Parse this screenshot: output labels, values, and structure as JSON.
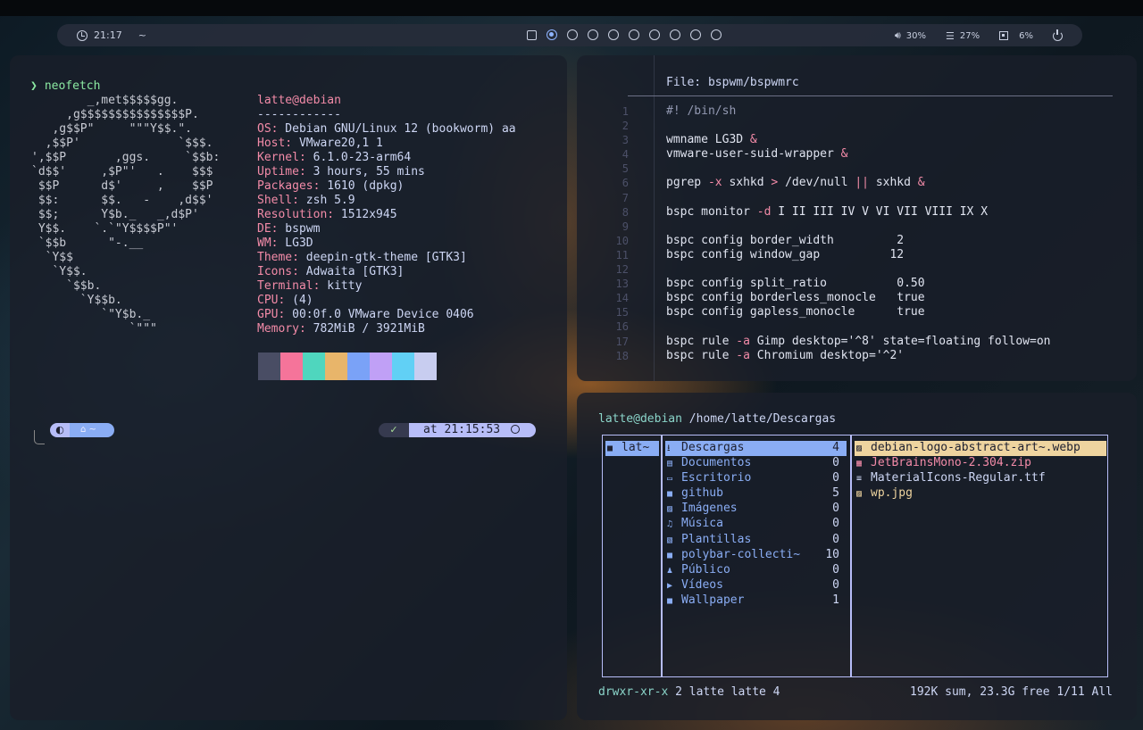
{
  "bar": {
    "time": "21:17",
    "tilde": "~",
    "workspaces": [
      "square",
      "active",
      "o",
      "o",
      "o",
      "o",
      "o",
      "o",
      "o",
      "o"
    ],
    "volume": "30%",
    "memory": "27%",
    "cpu": "6%"
  },
  "neofetch": {
    "command": "neofetch",
    "logo": "        _,met$$$$$gg.\n     ,g$$$$$$$$$$$$$$$P.\n   ,g$$P\"     \"\"\"Y$$.\".\n  ,$$P'              `$$$.\n',$$P       ,ggs.     `$$b:\n`d$$'     ,$P\"'   .    $$$\n $$P      d$'     ,    $$P\n $$:      $$.   -    ,d$$'\n $$;      Y$b._   _,d$P'\n Y$$.    `.`\"Y$$$$P\"'\n `$$b      \"-.__\n  `Y$$\n   `Y$$.\n     `$$b.\n       `Y$$b.\n          `\"Y$b._\n              `\"\"\"",
    "header": "latte@debian",
    "separator": "------------",
    "fields": [
      {
        "k": "OS",
        "v": "Debian GNU/Linux 12 (bookworm) aa"
      },
      {
        "k": "Host",
        "v": "VMware20,1 1"
      },
      {
        "k": "Kernel",
        "v": "6.1.0-23-arm64"
      },
      {
        "k": "Uptime",
        "v": "3 hours, 55 mins"
      },
      {
        "k": "Packages",
        "v": "1610 (dpkg)"
      },
      {
        "k": "Shell",
        "v": "zsh 5.9"
      },
      {
        "k": "Resolution",
        "v": "1512x945"
      },
      {
        "k": "DE",
        "v": "bspwm"
      },
      {
        "k": "WM",
        "v": "LG3D"
      },
      {
        "k": "Theme",
        "v": "deepin-gtk-theme [GTK3]"
      },
      {
        "k": "Icons",
        "v": "Adwaita [GTK3]"
      },
      {
        "k": "Terminal",
        "v": "kitty"
      },
      {
        "k": "CPU",
        "v": "(4)"
      },
      {
        "k": "GPU",
        "v": "00:0f.0 VMware Device 0406"
      },
      {
        "k": "Memory",
        "v": "782MiB / 3921MiB"
      }
    ],
    "palette": [
      "#494d64",
      "#f5749a",
      "#4fd6be",
      "#e8b56a",
      "#7aa2f7",
      "#c0a0f6",
      "#61d0f5",
      "#c8cdf0"
    ]
  },
  "prompt_line": {
    "home": "~",
    "status": "✓",
    "time": "at 21:15:53"
  },
  "editor": {
    "title": "File: bspwm/bspwmrc",
    "line_numbers": "1\n2\n3\n4\n5\n6\n7\n8\n9\n10\n11\n12\n13\n14\n15\n16\n17\n18",
    "lines": [
      "#! /bin/sh",
      "",
      "wmname LG3D &",
      "vmware-user-suid-wrapper &",
      "",
      "pgrep -x sxhkd > /dev/null || sxhkd &",
      "",
      "bspc monitor -d I II III IV V VI VII VIII IX X",
      "",
      "bspc config border_width         2",
      "bspc config window_gap          12",
      "",
      "bspc config split_ratio          0.50",
      "bspc config borderless_monocle   true",
      "bspc config gapless_monocle      true",
      "",
      "bspc rule -a Gimp desktop='^8' state=floating follow=on",
      "bspc rule -a Chromium desktop='^2'"
    ]
  },
  "ranger": {
    "user": "latte@debian",
    "path": "/home/latte/Descargas",
    "parent": "lat~",
    "dirs": [
      {
        "icon": "⭳",
        "name": "Descargas",
        "count": "4"
      },
      {
        "icon": "▤",
        "name": "Documentos",
        "count": "0"
      },
      {
        "icon": "▭",
        "name": "Escritorio",
        "count": "0"
      },
      {
        "icon": "■",
        "name": "github",
        "count": "5"
      },
      {
        "icon": "▨",
        "name": "Imágenes",
        "count": "0"
      },
      {
        "icon": "♫",
        "name": "Música",
        "count": "0"
      },
      {
        "icon": "▧",
        "name": "Plantillas",
        "count": "0"
      },
      {
        "icon": "■",
        "name": "polybar-collecti~",
        "count": "10"
      },
      {
        "icon": "♟",
        "name": "Público",
        "count": "0"
      },
      {
        "icon": "▶",
        "name": "Vídeos",
        "count": "0"
      },
      {
        "icon": "■",
        "name": "Wallpaper",
        "count": "1"
      }
    ],
    "files": [
      {
        "icon": "▨",
        "name": "debian-logo-abstract-art~.webp"
      },
      {
        "icon": "▦",
        "name": "JetBrainsMono-2.304.zip"
      },
      {
        "icon": "≡",
        "name": "MaterialIcons-Regular.ttf"
      },
      {
        "icon": "▨",
        "name": "wp.jpg"
      }
    ],
    "status_perm": "drwxr-xr-x",
    "status_info": "2 latte latte 4",
    "status_right": "192K sum, 23.3G free  1/11  All"
  }
}
